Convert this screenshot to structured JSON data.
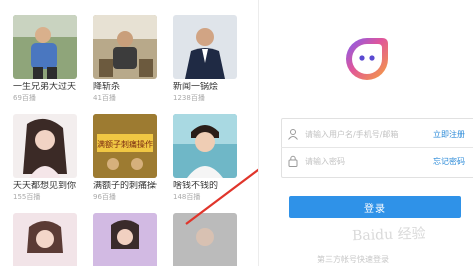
{
  "gallery": {
    "cards": [
      {
        "title": "一生兄弟大过天",
        "count": "69百播"
      },
      {
        "title": "降斩杀",
        "count": "41百播"
      },
      {
        "title": "新闻一锅烩",
        "count": "1238百播"
      },
      {
        "title": "天天都想见到你",
        "count": "155百播"
      },
      {
        "title": "满额子的刺痛操作",
        "count": "96百播"
      },
      {
        "title": "啥钱不钱的",
        "count": "148百播"
      },
      {
        "title": "",
        "count": ""
      },
      {
        "title": "",
        "count": ""
      },
      {
        "title": "",
        "count": ""
      }
    ],
    "thumb_overlay_text": "满额子刺痛操作"
  },
  "login": {
    "username_placeholder": "请输入用户名/手机号/邮箱",
    "register_link": "立即注册",
    "password_placeholder": "请输入密码",
    "forgot_link": "忘记密码",
    "submit_label": "登录",
    "third_party_label": "第三方帐号快速登录",
    "accent_color": "#2f92e8"
  },
  "watermark_text": "Baidu 经验",
  "icons": [
    "app-logo-icon",
    "user-icon",
    "lock-icon",
    "red-arrow"
  ]
}
